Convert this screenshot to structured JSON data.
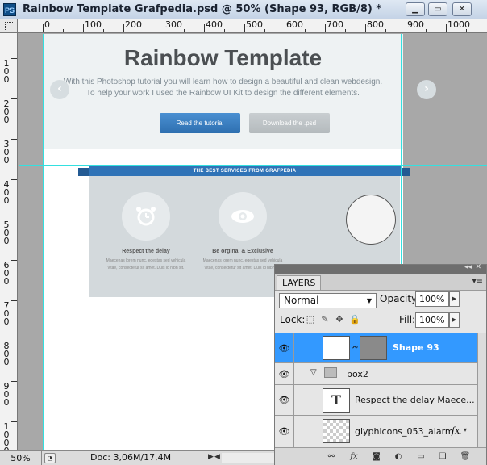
{
  "window": {
    "app_icon": "PS",
    "title": "Rainbow Template Grafpedia.psd @ 50% (Shape 93, RGB/8) *",
    "minimize_icon": "minimize-icon",
    "restore_icon": "restore-icon",
    "close_icon": "close-icon"
  },
  "ruler": {
    "h_labels": [
      "0",
      "100",
      "200",
      "300",
      "400",
      "500",
      "600",
      "700",
      "800",
      "900",
      "1000"
    ],
    "v_labels": [
      "1 0 0",
      "2 0 0",
      "3 0 0",
      "4 0 0",
      "5 0 0",
      "6 0 0",
      "7 0 0",
      "8 0 0",
      "9 0 0",
      "1 0 0 0"
    ]
  },
  "canvas": {
    "hero_title": "Rainbow Template",
    "hero_line1": "With this Photoshop tutorial you will learn how to design a beautiful and clean webdesign.",
    "hero_line2": "To help your work I used the Rainbow UI Kit to design the different elements.",
    "prev_arrow": "‹",
    "next_arrow": "›",
    "btn_tutorial": "Read the tutorial",
    "btn_download": "Download the .psd",
    "ribbon": "THE BEST SERVICES FROM GRAFPEDIA",
    "services": [
      {
        "icon": "alarm-clock-icon",
        "title": "Respect the delay",
        "text": "Maecenas lorem nunc, egestas sed vehicula vitae, consectetur sit amet. Duis id nibh sit."
      },
      {
        "icon": "eye-icon",
        "title": "Be orginal & Exclusive",
        "text": "Maecenas lorem nunc, egestas sed vehicula vitae, consectetur sit amet. Duis id nibh sit."
      }
    ]
  },
  "layers_panel": {
    "collapse": "◂◂",
    "close": "✕",
    "tab": "LAYERS",
    "menu": "▾≡",
    "blend_mode": "Normal",
    "opacity_label": "Opacity:",
    "opacity_value": "100%",
    "lock_label": "Lock:",
    "fill_label": "Fill:",
    "fill_value": "100%",
    "layers": [
      {
        "name": "Shape 93",
        "selected": true
      },
      {
        "name": "box2",
        "type": "group"
      },
      {
        "name": "Respect the delay Maece...",
        "type": "text",
        "thumb": "T"
      },
      {
        "name": "glyphicons_053_alarm...",
        "type": "smart",
        "fx": "fx"
      }
    ]
  },
  "status": {
    "zoom": "50%",
    "doc": "Doc: 3,06M/17,4M"
  },
  "colors": {
    "accent": "#3399ff",
    "button_blue": "#2e6fb0",
    "guide": "#33e0e0"
  }
}
